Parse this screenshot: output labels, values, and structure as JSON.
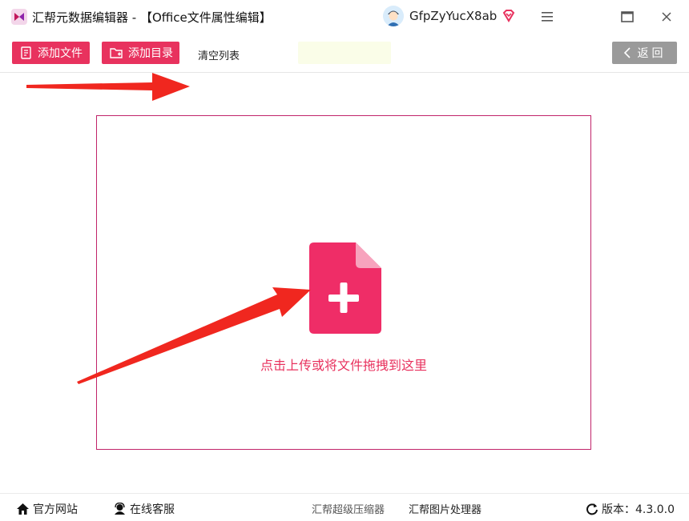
{
  "window": {
    "title": "汇帮元数据编辑器 - 【Office文件属性编辑】",
    "username": "GfpZyYucX8ab",
    "icons": {
      "logo": "app-logo-icon",
      "vip": "diamond-heart-icon",
      "menu": "menu-icon",
      "maximize": "maximize-icon",
      "close": "close-icon"
    }
  },
  "toolbar": {
    "add_file_label": "添加文件",
    "add_folder_label": "添加目录",
    "clear_label": "清空列表",
    "back_label": "返回",
    "icons": {
      "add_file": "file-list-icon",
      "add_folder": "folder-add-icon",
      "back": "chevron-left-icon"
    }
  },
  "dropzone": {
    "hint": "点击上传或将文件拖拽到这里",
    "icon": "file-plus-icon",
    "accent": "#e8325e",
    "border_color": "#c1246a"
  },
  "statusbar": {
    "website_label": "官方网站",
    "support_label": "在线客服",
    "compressor_label": "汇帮超级压缩器",
    "image_tool_label": "汇帮图片处理器",
    "version_label": "版本：4.3.0.0",
    "icons": {
      "website": "home-icon",
      "support": "headset-user-icon",
      "version": "refresh-icon"
    }
  },
  "annotations": {
    "arrow_color": "#f0271f"
  }
}
